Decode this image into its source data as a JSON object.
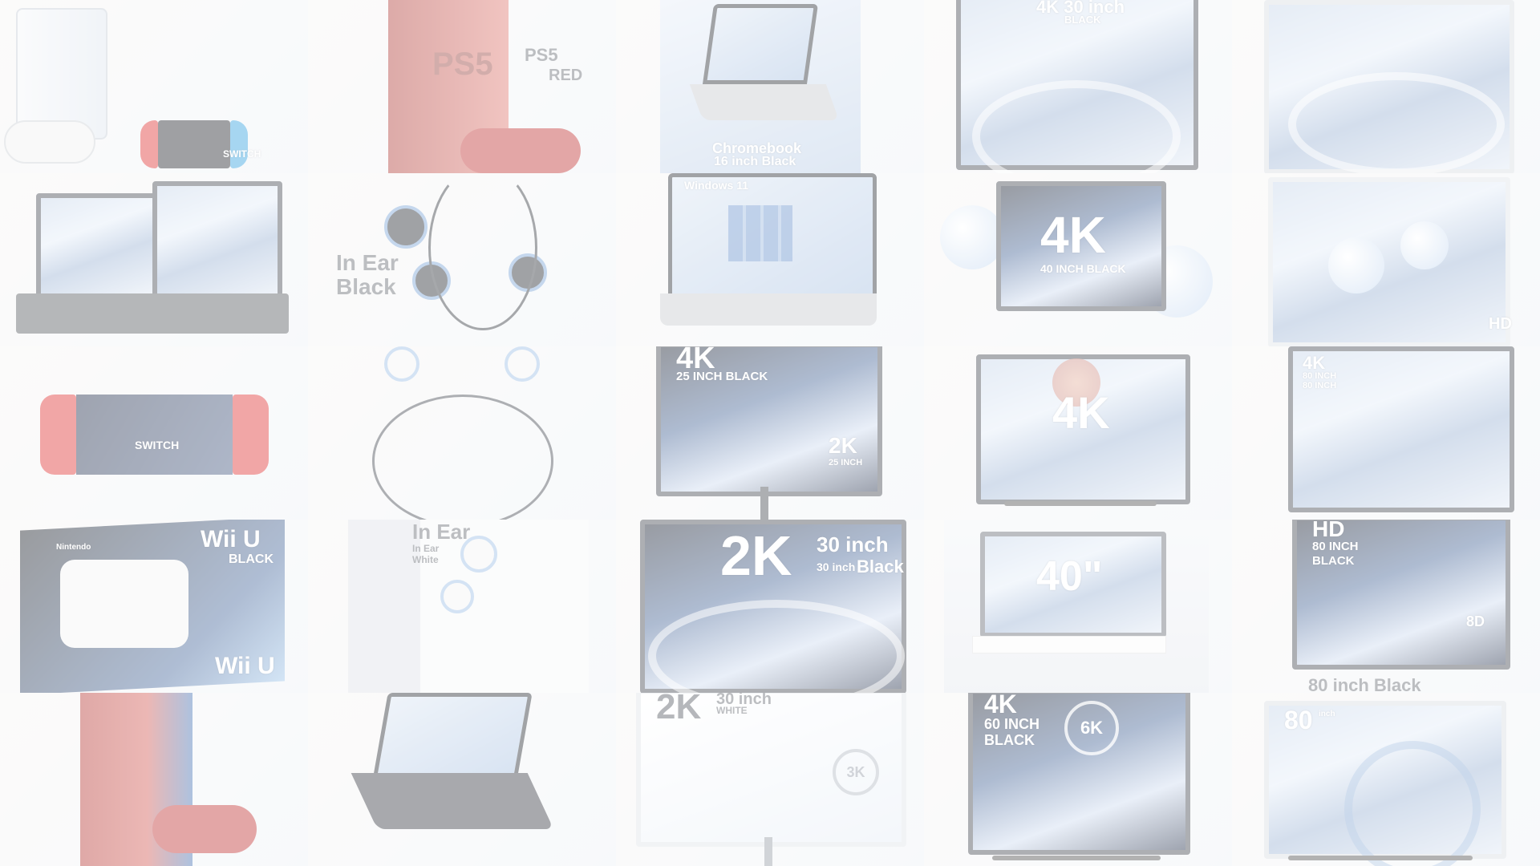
{
  "tiles": [
    {
      "name": "consoles-shelf",
      "texts": [
        "SWITCH"
      ]
    },
    {
      "name": "ps5-red-box",
      "texts": [
        "PS5",
        "PS5",
        "RED"
      ]
    },
    {
      "name": "chromebook-16",
      "texts": [
        "Chromebook",
        "16 inch Black"
      ]
    },
    {
      "name": "tv-4k-30-black",
      "texts": [
        "4K 30 inch",
        "BLACK"
      ]
    },
    {
      "name": "tv-abstract-white",
      "texts": []
    },
    {
      "name": "living-room-tvs",
      "texts": []
    },
    {
      "name": "in-ear-black",
      "texts": [
        "In Ear",
        "Black"
      ]
    },
    {
      "name": "windows-laptop",
      "texts": [
        "Windows 11"
      ]
    },
    {
      "name": "tv-4k-40-black",
      "texts": [
        "4K",
        "40 INCH BLACK"
      ]
    },
    {
      "name": "tv-hd-bubbles",
      "texts": [
        "HD"
      ]
    },
    {
      "name": "nintendo-switch",
      "texts": [
        "SWITCH"
      ]
    },
    {
      "name": "earphones-cable",
      "texts": []
    },
    {
      "name": "monitor-2k-25",
      "texts": [
        "4K",
        "25 INCH BLACK",
        "2K",
        "25 INCH"
      ]
    },
    {
      "name": "tv-4k-mountains",
      "texts": [
        "4K"
      ]
    },
    {
      "name": "tv-4k-80",
      "texts": [
        "4K",
        "80 INCH",
        "80 INCH"
      ]
    },
    {
      "name": "wii-u-black",
      "texts": [
        "Wii U",
        "BLACK",
        "Wii U",
        "Nintendo"
      ]
    },
    {
      "name": "in-ear-white",
      "texts": [
        "In Ear",
        "In Ear",
        "White"
      ]
    },
    {
      "name": "monitor-2k-30-black",
      "texts": [
        "2K",
        "30 inch",
        "30 inch",
        "Black"
      ]
    },
    {
      "name": "tv-40-room",
      "texts": [
        "40\""
      ]
    },
    {
      "name": "tv-hd-80-black",
      "texts": [
        "HD",
        "80 INCH",
        "BLACK",
        "8D",
        "80 inch Black"
      ]
    },
    {
      "name": "ps4-red",
      "texts": []
    },
    {
      "name": "laptop-flower",
      "texts": []
    },
    {
      "name": "monitor-2k-30-white",
      "texts": [
        "2K",
        "30 inch",
        "WHITE",
        "3K"
      ]
    },
    {
      "name": "tv-4k-60-black",
      "texts": [
        "4K",
        "60 INCH",
        "BLACK",
        "6K"
      ]
    },
    {
      "name": "tv-80-wave",
      "texts": [
        "80",
        "inch"
      ]
    }
  ]
}
